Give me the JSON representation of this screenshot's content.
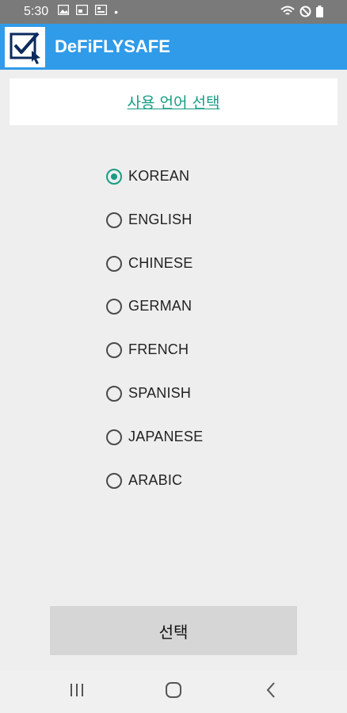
{
  "status_bar": {
    "time": "5:30",
    "left_icons": [
      "image-icon",
      "cast-icon",
      "card-icon"
    ],
    "dot": "•",
    "right_icons": [
      "wifi-icon",
      "do-not-disturb-icon",
      "battery-icon"
    ]
  },
  "app_bar": {
    "title": "DeFiFLYSAFE",
    "logo_icon": "checkbox-cursor-logo-icon",
    "color": "#2f9be9"
  },
  "header": {
    "title": "사용 언어 선택",
    "color": "#179c84"
  },
  "languages": {
    "selected": "KOREAN",
    "options": [
      {
        "label": "KOREAN",
        "checked": true
      },
      {
        "label": "ENGLISH",
        "checked": false
      },
      {
        "label": "CHINESE",
        "checked": false
      },
      {
        "label": "GERMAN",
        "checked": false
      },
      {
        "label": "FRENCH",
        "checked": false
      },
      {
        "label": "SPANISH",
        "checked": false
      },
      {
        "label": "JAPANESE",
        "checked": false
      },
      {
        "label": "ARABIC",
        "checked": false
      }
    ]
  },
  "select_button": {
    "label": "선택"
  },
  "nav_bar": {
    "items": [
      "recent-apps-icon",
      "home-icon",
      "back-icon"
    ]
  }
}
